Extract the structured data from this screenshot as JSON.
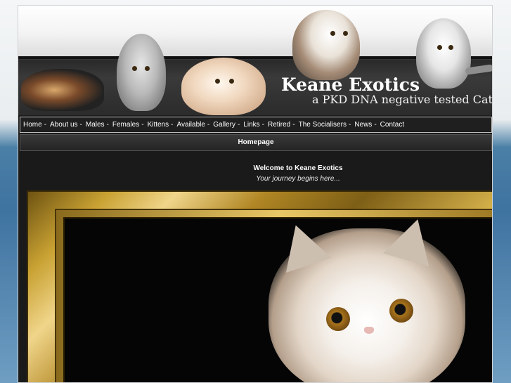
{
  "header": {
    "site_title": "Keane Exotics",
    "tagline": "a PKD DNA negative tested Catte"
  },
  "nav": {
    "items": [
      {
        "label": "Home"
      },
      {
        "label": "About us"
      },
      {
        "label": "Males"
      },
      {
        "label": "Females"
      },
      {
        "label": "Kittens"
      },
      {
        "label": "Available"
      },
      {
        "label": "Gallery"
      },
      {
        "label": "Links"
      },
      {
        "label": "Retired"
      },
      {
        "label": "The Socialisers"
      },
      {
        "label": "News"
      },
      {
        "label": "Contact"
      }
    ],
    "separator": "-"
  },
  "page": {
    "title": "Homepage",
    "welcome": "Welcome to Keane Exotics",
    "welcome_sub": "Your journey begins here..."
  }
}
